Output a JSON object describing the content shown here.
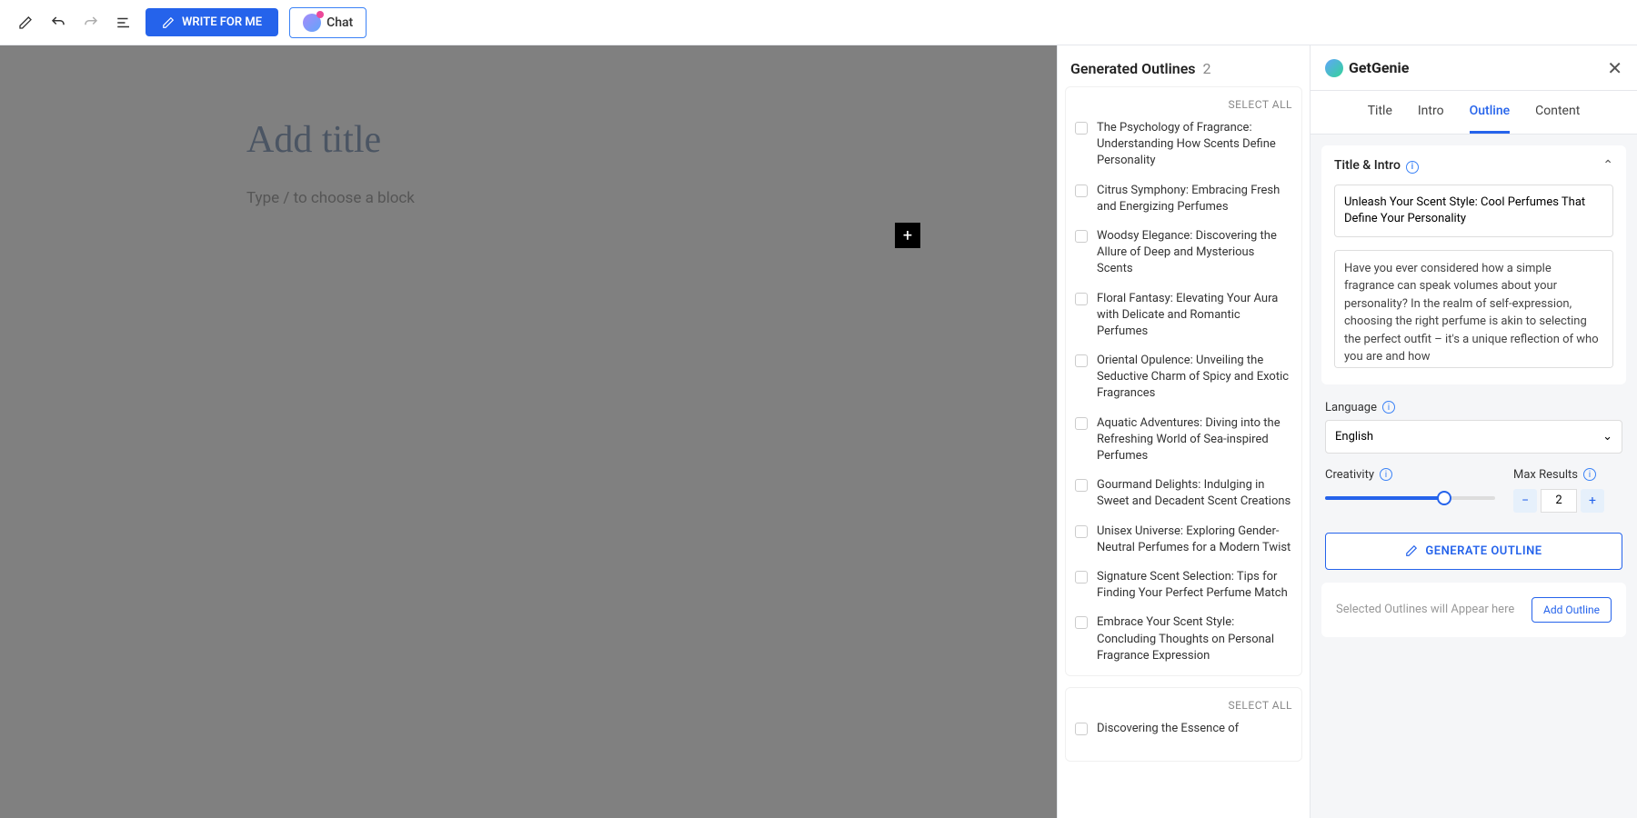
{
  "toolbar": {
    "write_label": "WRITE FOR ME",
    "chat_label": "Chat"
  },
  "editor": {
    "title_placeholder": "Add title",
    "block_placeholder": "Type / to choose a block"
  },
  "outlines": {
    "header": "Generated Outlines",
    "count": "2",
    "select_all": "SELECT ALL",
    "items": [
      "The Psychology of Fragrance: Understanding How Scents Define Personality",
      "Citrus Symphony: Embracing Fresh and Energizing Perfumes",
      "Woodsy Elegance: Discovering the Allure of Deep and Mysterious Scents",
      "Floral Fantasy: Elevating Your Aura with Delicate and Romantic Perfumes",
      "Oriental Opulence: Unveiling the Seductive Charm of Spicy and Exotic Fragrances",
      "Aquatic Adventures: Diving into the Refreshing World of Sea-inspired Perfumes",
      "Gourmand Delights: Indulging in Sweet and Decadent Scent Creations",
      "Unisex Universe: Exploring Gender-Neutral Perfumes for a Modern Twist",
      "Signature Scent Selection: Tips for Finding Your Perfect Perfume Match",
      "Embrace Your Scent Style: Concluding Thoughts on Personal Fragrance Expression"
    ],
    "second_card_first": "Discovering the Essence of"
  },
  "side": {
    "brand": "GetGenie",
    "tabs": {
      "title": "Title",
      "intro": "Intro",
      "outline": "Outline",
      "content": "Content"
    },
    "title_intro_label": "Title & Intro",
    "title_value": "Unleash Your Scent Style: Cool Perfumes That Define Your Personality",
    "intro_value": "Have you ever considered how a simple fragrance can speak volumes about your personality? In the realm of self-expression, choosing the right perfume is akin to selecting the perfect outfit – it's a unique reflection of who you are and how",
    "language_label": "Language",
    "language_value": "English",
    "creativity_label": "Creativity",
    "max_results_label": "Max Results",
    "max_results_value": "2",
    "generate_label": "GENERATE OUTLINE",
    "selected_placeholder": "Selected Outlines will Appear here",
    "add_outline_label": "Add Outline"
  }
}
